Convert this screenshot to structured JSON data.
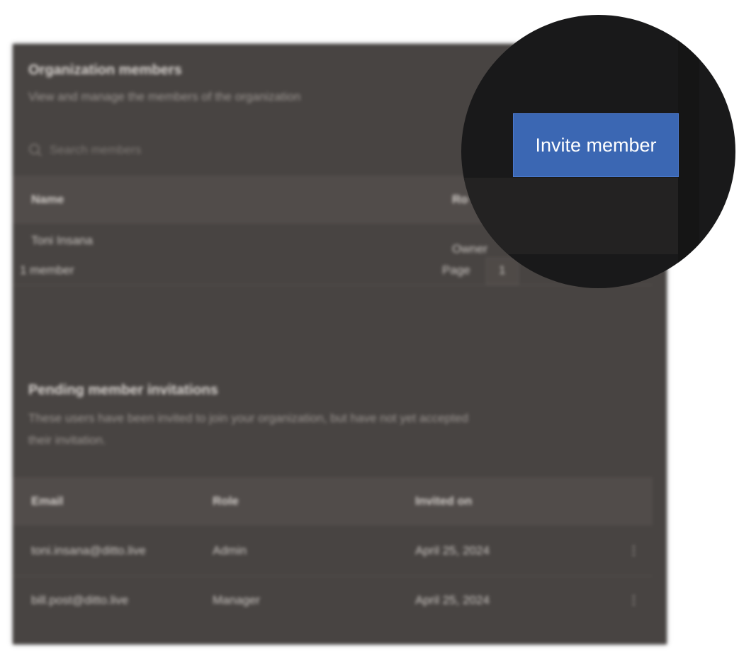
{
  "members_section": {
    "title": "Organization members",
    "description": "View and manage the members of the organization",
    "search_placeholder": "Search members",
    "columns": {
      "name": "Name",
      "role": "Ro"
    },
    "rows": [
      {
        "name": "Toni Insana",
        "role": "Owner"
      }
    ],
    "footer": {
      "count": "1 member",
      "page_label": "Page",
      "page_number": "1"
    }
  },
  "invite_button": {
    "label": "Invite member"
  },
  "invitations_section": {
    "title": "Pending member invitations",
    "description_line1": "These users have been invited to join your organization, but have not yet accepted",
    "description_line2": "their invitation.",
    "columns": {
      "email": "Email",
      "role": "Role",
      "invited_on": "Invited on"
    },
    "rows": [
      {
        "email": "toni.insana@ditto.live",
        "role": "Admin",
        "invited_on": "April 25, 2024",
        "menu": "⋮"
      },
      {
        "email": "bill.post@ditto.live",
        "role": "Manager",
        "invited_on": "April 25, 2024",
        "menu": "⋮"
      }
    ]
  },
  "colors": {
    "panel_bg": "#484442",
    "magnifier_bg": "#19191a",
    "accent_button": "#3b67b3"
  }
}
